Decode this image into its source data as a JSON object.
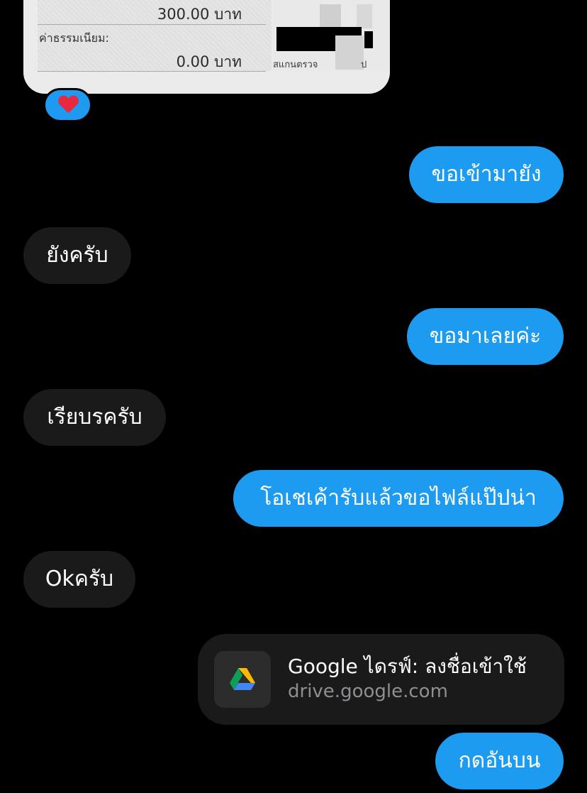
{
  "receipt": {
    "amount_top": "300.00 บาท",
    "fee_label": "ค่าธรรมเนียม:",
    "fee_amount": "0.00 บาท",
    "scan_caption": "สแกนตรวจ",
    "scan_caption_tail": "ป"
  },
  "reaction": {
    "emoji_name": "red-heart",
    "bubble_color": "#1e9bf0",
    "heart_color": "#e8283e"
  },
  "messages": [
    {
      "side": "out",
      "text": "ขอเข้ามายัง"
    },
    {
      "side": "in",
      "text": "ยังครับ"
    },
    {
      "side": "out",
      "text": "ขอมาเลยค่ะ"
    },
    {
      "side": "in",
      "text": "เรียบรครับ"
    },
    {
      "side": "out",
      "text": "โอเชเค้ารับแล้วขอไฟล์แป๊ปน่า"
    },
    {
      "side": "in",
      "text": "Okครับ"
    }
  ],
  "link_card": {
    "title": "Google ไดรฟ์: ลงชื่อเข้าใช้",
    "domain": "drive.google.com",
    "icon": "google-drive-icon"
  },
  "last_message": {
    "side": "out",
    "text": "กดอันบน"
  },
  "colors": {
    "background": "#000000",
    "outgoing_bubble": "#1d9bf0",
    "incoming_bubble": "#1a1a1a",
    "link_domain": "#8e8e93"
  }
}
